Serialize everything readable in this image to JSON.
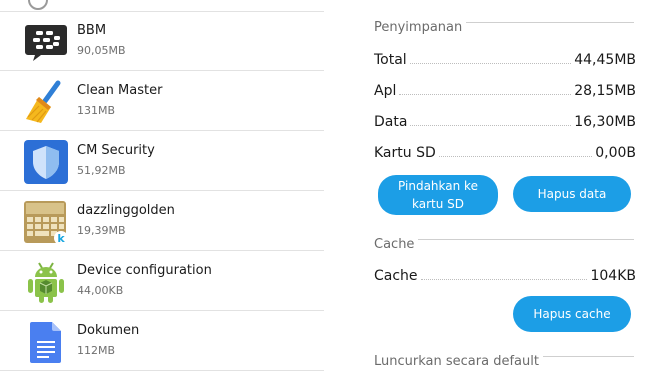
{
  "apps": [
    {
      "name": "BBM",
      "size": "90,05MB",
      "icon": "bbm-icon"
    },
    {
      "name": "Clean Master",
      "size": "131MB",
      "icon": "clean-master-icon"
    },
    {
      "name": "CM Security",
      "size": "51,92MB",
      "icon": "cm-security-icon"
    },
    {
      "name": "dazzlinggolden",
      "size": "19,39MB",
      "icon": "keyboard-theme-icon"
    },
    {
      "name": "Device configuration",
      "size": "44,00KB",
      "icon": "android-icon"
    },
    {
      "name": "Dokumen",
      "size": "112MB",
      "icon": "docs-icon"
    }
  ],
  "storage": {
    "title": "Penyimpanan",
    "rows": [
      {
        "label": "Total",
        "value": "44,45MB"
      },
      {
        "label": "Apl",
        "value": "28,15MB"
      },
      {
        "label": "Data",
        "value": "16,30MB"
      },
      {
        "label": "Kartu SD",
        "value": "0,00B"
      }
    ],
    "move_button": "Pindahkan ke kartu SD",
    "clear_data_button": "Hapus data"
  },
  "cache": {
    "title": "Cache",
    "label": "Cache",
    "value": "104KB",
    "clear_cache_button": "Hapus cache"
  },
  "launch_default": {
    "title": "Luncurkan secara default"
  },
  "colors": {
    "accent": "#1c9ee6",
    "divider": "#e2e2e2"
  }
}
